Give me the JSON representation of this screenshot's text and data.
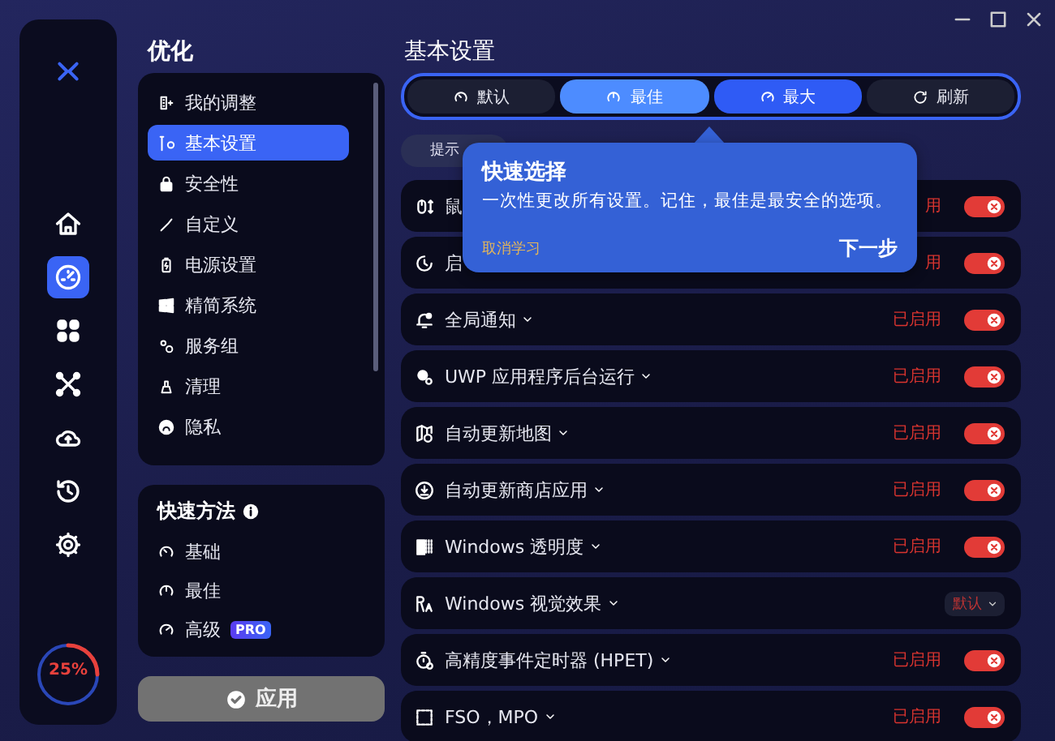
{
  "rail": {
    "items": [
      {
        "selected": false
      },
      {
        "selected": true
      },
      {
        "selected": false
      },
      {
        "selected": false
      },
      {
        "selected": false
      },
      {
        "selected": false
      },
      {
        "selected": false
      }
    ],
    "usage": {
      "level": 0.25,
      "reading": "25%"
    }
  },
  "section": {
    "title": "优化"
  },
  "sidebar": {
    "items": [
      {
        "label": "我的调整",
        "selected": false
      },
      {
        "label": "基本设置",
        "selected": true
      },
      {
        "label": "安全性",
        "selected": false
      },
      {
        "label": "自定义",
        "selected": false
      },
      {
        "label": "电源设置",
        "selected": false
      },
      {
        "label": "精简系统",
        "selected": false
      },
      {
        "label": "服务组",
        "selected": false
      },
      {
        "label": "清理",
        "selected": false
      },
      {
        "label": "隐私",
        "selected": false
      }
    ]
  },
  "quick_methods": {
    "title": "快速方法",
    "items": [
      {
        "label": "基础"
      },
      {
        "label": "最佳"
      },
      {
        "label": "高级",
        "badge": "PRO"
      }
    ]
  },
  "apply_button": {
    "label": "应用",
    "disabled": true
  },
  "page": {
    "title": "基本设置"
  },
  "presets": [
    {
      "label": "默认",
      "selected": false,
      "highlighted": false
    },
    {
      "label": "最佳",
      "selected": false,
      "highlighted": true
    },
    {
      "label": "最大",
      "selected": true,
      "highlighted": false
    },
    {
      "label": "刷新",
      "selected": false,
      "highlighted": false
    }
  ],
  "hint_chip": {
    "label": "提示"
  },
  "tooltip": {
    "title": "快速选择",
    "text": "一次性更改所有设置。记住，最佳是最安全的选项。",
    "dismiss": "取消学习",
    "next": "下一步"
  },
  "settings": [
    {
      "kind": "toggle",
      "label": "鼠",
      "status": "用",
      "on": true,
      "chevron": false
    },
    {
      "kind": "toggle",
      "label": "启",
      "status": "用",
      "on": true,
      "chevron": false
    },
    {
      "kind": "toggle",
      "label": "全局通知",
      "status": "已启用",
      "on": true,
      "chevron": true
    },
    {
      "kind": "toggle",
      "label": "UWP 应用程序后台运行",
      "status": "已启用",
      "on": true,
      "chevron": true
    },
    {
      "kind": "toggle",
      "label": "自动更新地图",
      "status": "已启用",
      "on": true,
      "chevron": true
    },
    {
      "kind": "toggle",
      "label": "自动更新商店应用",
      "status": "已启用",
      "on": true,
      "chevron": true
    },
    {
      "kind": "toggle",
      "label": "Windows 透明度",
      "status": "已启用",
      "on": true,
      "chevron": true
    },
    {
      "kind": "dropdown",
      "label": "Windows 视觉效果",
      "status": "默认",
      "chevron": true
    },
    {
      "kind": "toggle",
      "label": "高精度事件定时器 (HPET)",
      "status": "已启用",
      "on": true,
      "chevron": true
    },
    {
      "kind": "toggle",
      "label": "FSO，MPO",
      "status": "已启用",
      "on": true,
      "chevron": true
    }
  ]
}
